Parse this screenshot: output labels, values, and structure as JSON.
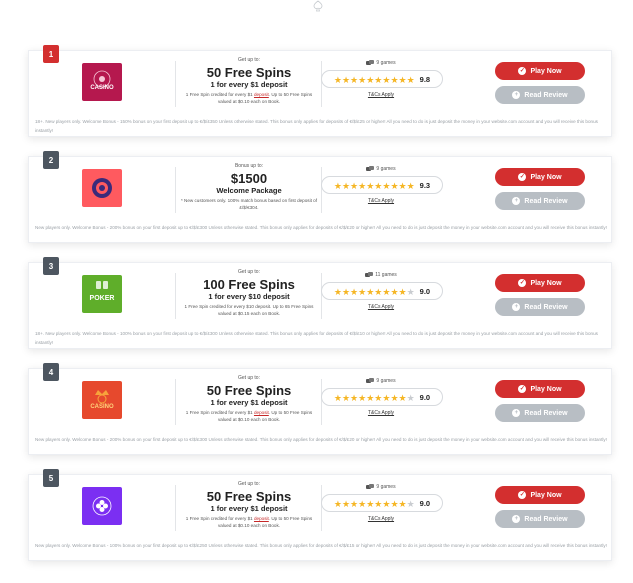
{
  "colors": {
    "accent": "#d32f2f",
    "star": "#f5b625",
    "muted": "#b8bec4"
  },
  "cards": [
    {
      "rank": "1",
      "rank_style": "red",
      "logo": {
        "icon": "casino-logo",
        "bg": "#b5184e",
        "text": "CASINO"
      },
      "offer": {
        "top_label": "Get up to:",
        "headline": "50 Free Spins",
        "sub": "1 for every $1 deposit",
        "fine_pre": "1 Free Spin credited for every $1",
        "fine_link": "deposit",
        "fine_post": ". Up to 50 Free Spins valued at $0.10 each on Book."
      },
      "games": "9 games",
      "rating": 9.8,
      "stars_full": 10,
      "tcs": "T&Cs Apply",
      "play_label": "Play Now",
      "review_label": "Read Review",
      "terms": "18+. New players only. Welcome Bonus - 150% bonus on your first deposit up to €/$/£350 Unless otherwise stated. This bonus only applies for deposits of €/$/£25 or higher! All you need to do is just deposit the money in your website.com account and you will receive this bonus instantly!"
    },
    {
      "rank": "2",
      "rank_style": "dark",
      "logo": {
        "icon": "chip-logo",
        "bg": "#ff5a5f",
        "text": ""
      },
      "offer": {
        "top_label": "Bonus up to:",
        "headline": "$1500",
        "sub": "Welcome Package",
        "fine_pre": "* New customers only. 100% match bonus based on first deposit of £/$/€304.",
        "fine_link": "",
        "fine_post": ""
      },
      "games": "9 games",
      "rating": 9.3,
      "stars_full": 10,
      "tcs": "T&Cs Apply",
      "play_label": "Play Now",
      "review_label": "Read Review",
      "terms": "New players only. Welcome Bonus - 200% bonus on your first deposit up to €/$/£300 Unless otherwise stated. This bonus only applies for deposits of €/$/£20 or higher! All you need to do is just deposit the money in your website.com account and you will receive this bonus instantly!"
    },
    {
      "rank": "3",
      "rank_style": "dark",
      "logo": {
        "icon": "poker-logo",
        "bg": "#5fae2a",
        "text": "POKER"
      },
      "offer": {
        "top_label": "Get up to:",
        "headline": "100 Free Spins",
        "sub": "1 for every $10 deposit",
        "fine_pre": "1 Free Spin credited for every $10 deposit. Up to 65 Free Spins valued at $0.15 each on Book.",
        "fine_link": "",
        "fine_post": ""
      },
      "games": "11 games",
      "rating": 9.0,
      "stars_full": 9,
      "tcs": "T&Cs Apply",
      "play_label": "Play Now",
      "review_label": "Read Review",
      "terms": "18+. New players only. Welcome Bonus - 100% bonus on your first deposit up to €/$/£300 Unless otherwise stated. This bonus only applies for deposits of €/$/£10 or higher! All you need to do is just deposit the money in your website.com account and you will receive this bonus instantly!"
    },
    {
      "rank": "4",
      "rank_style": "dark",
      "logo": {
        "icon": "casino-crown-logo",
        "bg": "#e6492d",
        "text": "CASINO"
      },
      "offer": {
        "top_label": "Get up to:",
        "headline": "50 Free Spins",
        "sub": "1 for every $1 deposit",
        "fine_pre": "1 Free Spin credited for every $1",
        "fine_link": "deposit",
        "fine_post": ". Up to 50 Free Spins valued at $0.10 each on Book."
      },
      "games": "9 games",
      "rating": 9.0,
      "stars_full": 9,
      "tcs": "T&Cs Apply",
      "play_label": "Play Now",
      "review_label": "Read Review",
      "terms": "New players only. Welcome Bonus - 200% bonus on your first deposit up to €/$/£300 Unless otherwise stated. This bonus only applies for deposits of €/$/£20 or higher! All you need to do is just deposit the money in your website.com account and you will receive this bonus instantly!"
    },
    {
      "rank": "5",
      "rank_style": "dark",
      "logo": {
        "icon": "clover-logo",
        "bg": "#7b2ff2",
        "text": ""
      },
      "offer": {
        "top_label": "Get up to:",
        "headline": "50 Free Spins",
        "sub": "1 for every $1 deposit",
        "fine_pre": "1 Free Spin credited for every $1",
        "fine_link": "deposit",
        "fine_post": ". Up to 50 Free Spins valued at $0.10 each on Book."
      },
      "games": "9 games",
      "rating": 9.0,
      "stars_full": 9,
      "tcs": "T&Cs Apply",
      "play_label": "Play Now",
      "review_label": "Read Review",
      "terms": "New players only. Welcome Bonus - 100% bonus on your first deposit up to €/$/£250 Unless otherwise stated. This bonus only applies for deposits of €/$/£15 or higher! All you need to do is just deposit the money in your website.com account and you will receive this bonus instantly!"
    }
  ]
}
